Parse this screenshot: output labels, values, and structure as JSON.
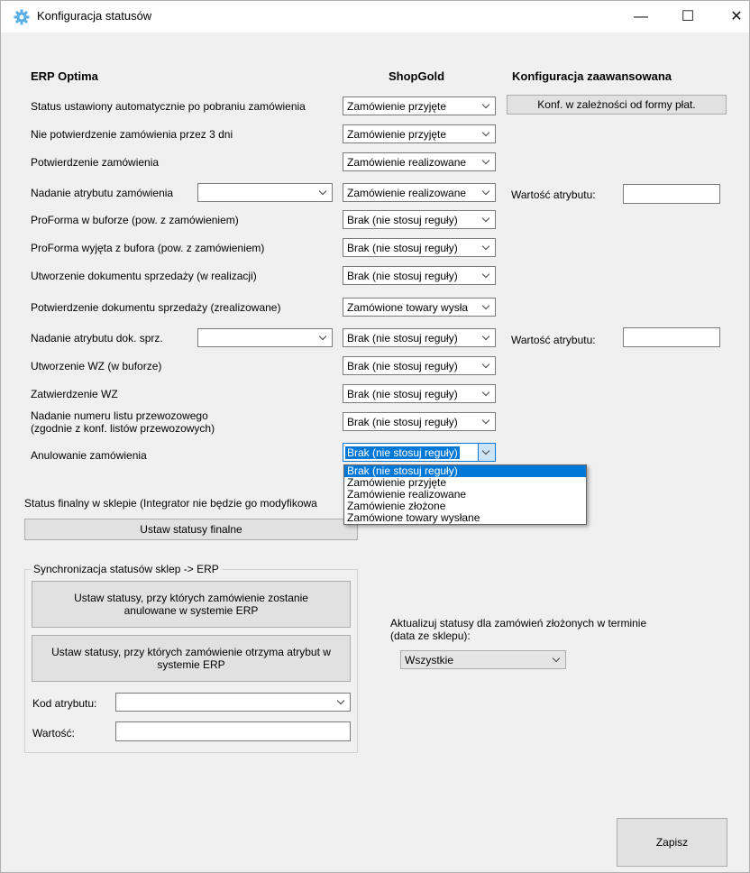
{
  "window": {
    "title": "Konfiguracja statusów",
    "controls": {
      "minimize": "—",
      "maximize": "☐",
      "close": "✕"
    }
  },
  "headers": {
    "erp": "ERP Optima",
    "shop": "ShopGold",
    "advanced": "Konfiguracja zaawansowana"
  },
  "rows": [
    {
      "label": "Status ustawiony automatycznie po pobraniu zamówienia",
      "shop_value": "Zamówienie przyjęte"
    },
    {
      "label": "Nie potwierdzenie zamówienia przez 3 dni",
      "shop_value": "Zamówienie przyjęte"
    },
    {
      "label": "Potwierdzenie zamówienia",
      "shop_value": "Zamówienie realizowane"
    },
    {
      "label": "Nadanie atrybutu zamówienia",
      "shop_value": "Zamówienie realizowane"
    },
    {
      "label": "ProForma w buforze (pow. z zamówieniem)",
      "shop_value": "Brak (nie stosuj reguły)"
    },
    {
      "label": "ProForma wyjęta z bufora (pow. z zamówieniem)",
      "shop_value": "Brak (nie stosuj reguły)"
    },
    {
      "label": "Utworzenie dokumentu sprzedaży (w realizacji)",
      "shop_value": "Brak (nie stosuj reguły)"
    },
    {
      "label": "Potwierdzenie dokumentu sprzedaży (zrealizowane)",
      "shop_value": "Zamówione towary wysła"
    },
    {
      "label": "Nadanie atrybutu dok. sprz.",
      "shop_value": "Brak (nie stosuj reguły)"
    },
    {
      "label": "Utworzenie WZ (w buforze)",
      "shop_value": "Brak (nie stosuj reguły)"
    },
    {
      "label": "Zatwierdzenie WZ",
      "shop_value": "Brak (nie stosuj reguły)"
    },
    {
      "label": "Nadanie numeru listu przewozowego",
      "label2": "(zgodnie z konf. listów przewozowych)",
      "shop_value": "Brak (nie stosuj reguły)"
    },
    {
      "label": "Anulowanie zamówienia",
      "shop_value": "Brak (nie stosuj reguły)"
    }
  ],
  "advanced": {
    "payment_button": "Konf. w zależności od formy płat.",
    "attr_value_label": "Wartość atrybutu:",
    "attr_value_label2": "Wartość atrybutu:"
  },
  "dropdown_options": [
    "Brak (nie stosuj reguły)",
    "Zamówienie przyjęte",
    "Zamówienie realizowane",
    "Zamówienie złożone",
    "Zamówione towary wysłane"
  ],
  "final": {
    "label": "Status finalny w sklepie (Integrator nie będzie go modyfikowa",
    "button": "Ustaw statusy finalne"
  },
  "sync": {
    "title": "Synchronizacja statusów sklep -> ERP",
    "cancel_button": "Ustaw statusy, przy których zamówienie zostanie anulowane w systemie ERP",
    "attribute_button": "Ustaw statusy, przy których zamówienie otrzyma atrybut w systemie ERP",
    "attr_code_label": "Kod atrybutu:",
    "attr_code_value": "",
    "value_label": "Wartość:",
    "value_value": ""
  },
  "update": {
    "label": "Aktualizuj statusy dla zamówień złożonych w terminie",
    "label2": "(data ze sklepu):",
    "value": "Wszystkie"
  },
  "save_button": "Zapisz"
}
